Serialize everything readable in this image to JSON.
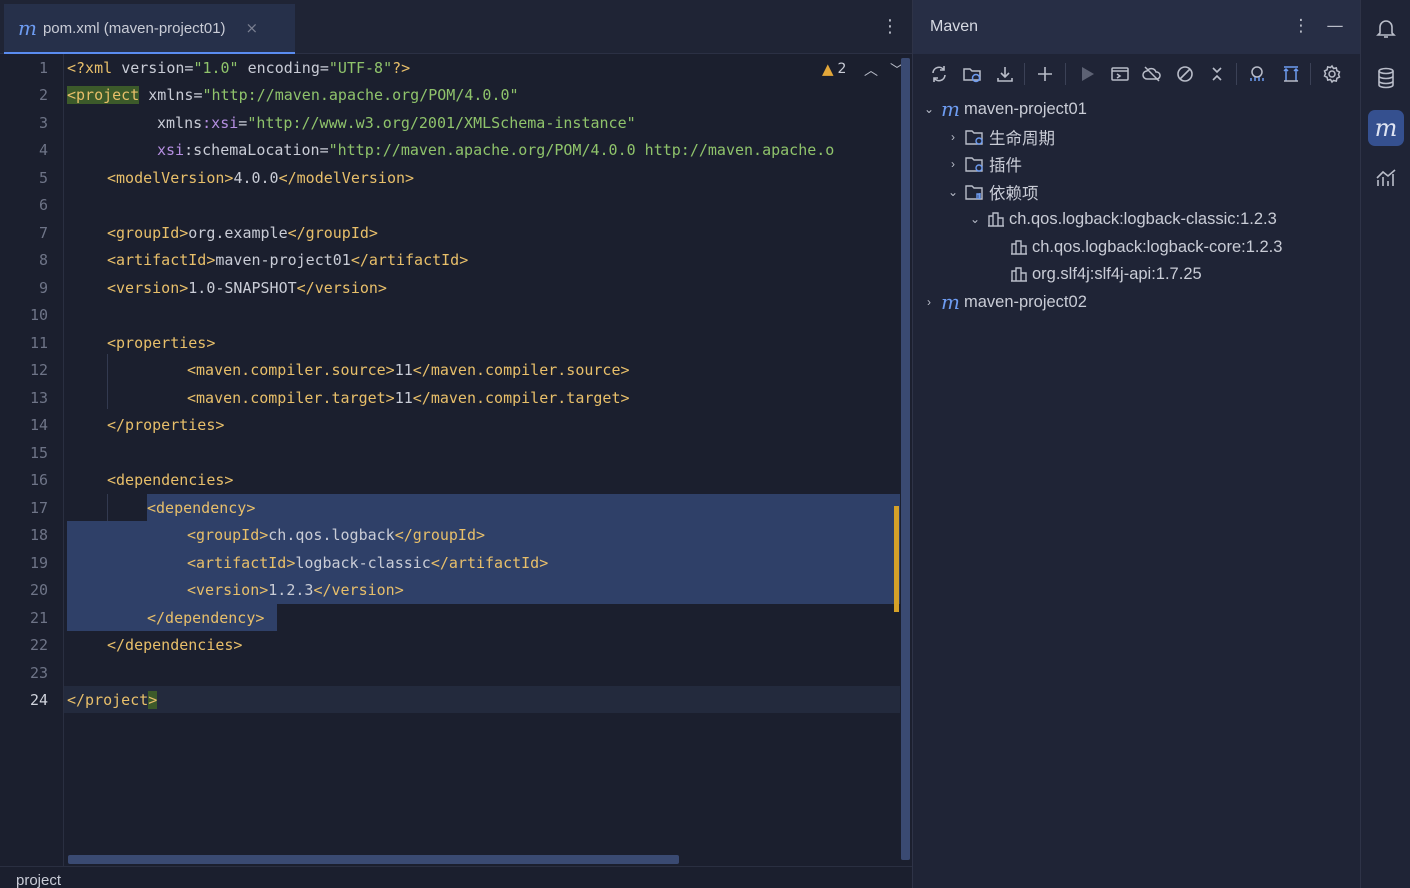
{
  "editor": {
    "tab": {
      "title": "pom.xml (maven-project01)",
      "icon": "maven-m-icon",
      "close_glyph": "×"
    },
    "inspection": {
      "warning_count": "2"
    },
    "line_numbers": [
      "1",
      "2",
      "3",
      "4",
      "5",
      "6",
      "7",
      "8",
      "9",
      "10",
      "11",
      "12",
      "13",
      "14",
      "15",
      "16",
      "17",
      "18",
      "19",
      "20",
      "21",
      "22",
      "23",
      "24"
    ],
    "current_line": "24",
    "code": {
      "l1": {
        "p1": "<?xml ",
        "p2": "version",
        "p3": "=",
        "p4": "\"1.0\"",
        "p5": " encoding",
        "p6": "=",
        "p7": "\"UTF-8\"",
        "p8": "?>"
      },
      "l2": {
        "p1": "<project",
        "p2": " xmlns",
        "p3": "=",
        "p4": "\"http://maven.apache.org/POM/4.0.0\""
      },
      "l3": {
        "p1": "xmlns",
        "p2": ":xsi",
        "p3": "=",
        "p4": "\"http://www.w3.org/2001/XMLSchema-instance\""
      },
      "l4": {
        "p1": "xsi",
        "p2": ":schemaLocation",
        "p3": "=",
        "p4": "\"http://maven.apache.org/POM/4.0.0 http://maven.apache.o"
      },
      "l5": {
        "open": "<modelVersion>",
        "text": "4.0.0",
        "close": "</modelVersion>"
      },
      "l7": {
        "open": "<groupId>",
        "text": "org.example",
        "close": "</groupId>"
      },
      "l8": {
        "open": "<artifactId>",
        "text": "maven-project01",
        "close": "</artifactId>"
      },
      "l9": {
        "open": "<version>",
        "text": "1.0-SNAPSHOT",
        "close": "</version>"
      },
      "l11": {
        "open": "<properties>"
      },
      "l12": {
        "open": "<maven.compiler.source>",
        "text": "11",
        "close": "</maven.compiler.source>"
      },
      "l13": {
        "open": "<maven.compiler.target>",
        "text": "11",
        "close": "</maven.compiler.target>"
      },
      "l14": {
        "close": "</properties>"
      },
      "l16": {
        "open": "<dependencies>"
      },
      "l17": {
        "open": "<dependency>"
      },
      "l18": {
        "open": "<groupId>",
        "text": "ch.qos.logback",
        "close": "</groupId>"
      },
      "l19": {
        "open": "<artifactId>",
        "text": "logback-classic",
        "close": "</artifactId>"
      },
      "l20": {
        "open": "<version>",
        "text": "1.2.3",
        "close": "</version>"
      },
      "l21": {
        "close": "</dependency>"
      },
      "l22": {
        "close": "</dependencies>"
      },
      "l24": {
        "close1": "</project",
        "close2": ">"
      }
    },
    "breadcrumb": "project"
  },
  "maven": {
    "title": "Maven",
    "toolbar": [
      "reload-icon",
      "reload-folder-icon",
      "download-icon",
      "add-icon",
      "run-icon",
      "execute-goal-icon",
      "offline-icon",
      "skip-tests-icon",
      "collapse-icon",
      "show-dependencies-icon",
      "expand-all-icon",
      "settings-icon"
    ],
    "tree": {
      "project1": {
        "label": "maven-project01",
        "expanded": true
      },
      "lifecycle": {
        "label": "生命周期",
        "expanded": false
      },
      "plugins": {
        "label": "插件",
        "expanded": false
      },
      "dependencies": {
        "label": "依赖项",
        "expanded": true
      },
      "dep1": {
        "label": "ch.qos.logback:logback-classic:1.2.3",
        "expanded": true
      },
      "dep1a": {
        "label": "ch.qos.logback:logback-core:1.2.3"
      },
      "dep1b": {
        "label": "org.slf4j:slf4j-api:1.7.25"
      },
      "project2": {
        "label": "maven-project02",
        "expanded": false
      }
    }
  },
  "right_strip": [
    "notifications-icon",
    "database-icon",
    "maven-icon",
    "profiler-icon"
  ],
  "colors": {
    "background": "#1b1f2e",
    "tag": "#e8bf6a",
    "string": "#8fc36b",
    "selection": "#2f4068",
    "accent": "#35508f",
    "warning": "#d5a128"
  }
}
